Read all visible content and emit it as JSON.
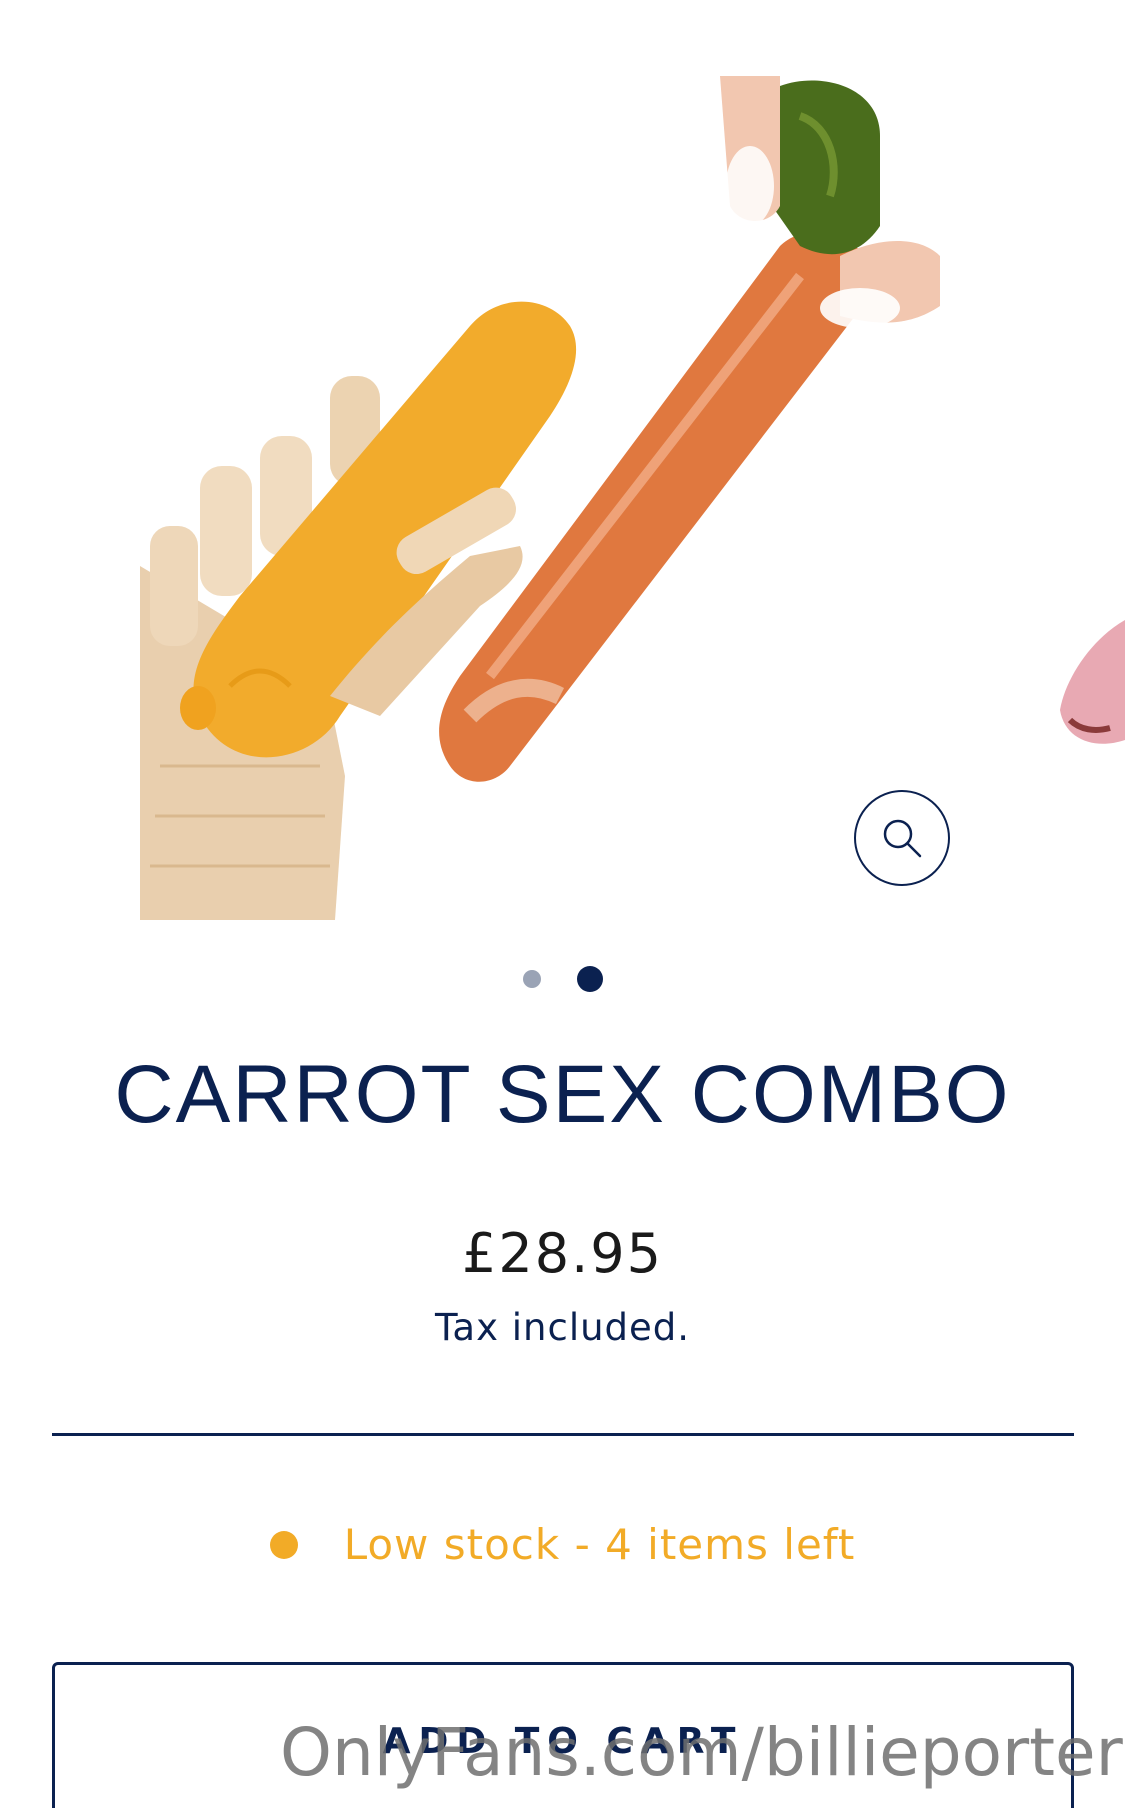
{
  "product": {
    "title": "CARROT SEX COMBO",
    "price": "£28.95",
    "tax_note": "Tax included.",
    "stock_text": "Low stock - 4 items left",
    "add_to_cart_label": "ADD TO CART"
  },
  "gallery": {
    "image_count": 2,
    "active_index": 1,
    "zoom_icon": "search-icon"
  },
  "watermark": "OnlyFans.com/billieporter",
  "colors": {
    "navy": "#0b2150",
    "stock_amber": "#f2ab27",
    "inactive_dot": "#9aa3b5"
  }
}
